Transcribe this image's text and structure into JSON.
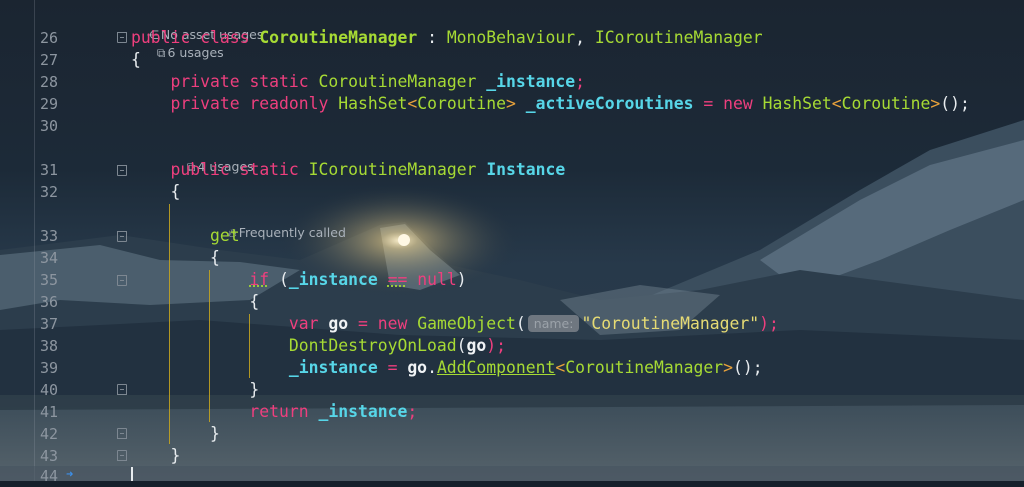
{
  "editor": {
    "hints": {
      "h1_assets": "No asset usages",
      "h1_usages": "6 usages",
      "h2_usages": "4 usages",
      "h3_freq": "Frequently called"
    },
    "line_numbers": {
      "l26": "26",
      "l27": "27",
      "l28": "28",
      "l29": "29",
      "l30": "30",
      "l31": "31",
      "l32": "32",
      "l33": "33",
      "l34": "34",
      "l35": "35",
      "l36": "36",
      "l37": "37",
      "l38": "38",
      "l39": "39",
      "l40": "40",
      "l41": "41",
      "l42": "42",
      "l43": "43",
      "l44": "44"
    },
    "tokens": {
      "public": "public",
      "class": "class",
      "CoroutineManager": "CoroutineManager",
      "colon": " : ",
      "MonoBehaviour": "MonoBehaviour",
      "comma": ", ",
      "ICoroutineManager": "ICoroutineManager",
      "lbrace": "{",
      "rbrace": "}",
      "private": "private",
      "static": "static",
      "readonly": "readonly",
      "_instance": "_instance",
      "semi": ";",
      "HashSet": "HashSet",
      "lt": "<",
      "gt": ">",
      "Coroutine": "Coroutine",
      "_activeCoroutines": "_activeCoroutines",
      "eq": " = ",
      "new": "new",
      "parens_semi": "();",
      "Instance": "Instance",
      "get": "get",
      "if": "if",
      "lparen": "(",
      "eqeq": "==",
      "null": "null",
      "rparen": ")",
      "var": "var",
      "go": "go",
      "GameObject": "GameObject",
      "name_hint": "name:",
      "str_cm": "\"CoroutineManager\"",
      "rparen_semi": ");",
      "DontDestroyOnLoad": "DontDestroyOnLoad",
      "dot": ".",
      "AddComponent": "AddComponent",
      "return": "return"
    }
  },
  "icons": {
    "asset_icon": "share-nodes-icon",
    "usages_icon": "arrow-up-right-box-icon",
    "frequent_icon": "flame-icon",
    "gutter_action_icon": "arrow-right-icon"
  },
  "colors": {
    "keyword": "#ee3f7e",
    "type": "#a6da34",
    "field": "#57d6e8",
    "string": "#e6db74",
    "indent_guide": "#c2a321"
  }
}
